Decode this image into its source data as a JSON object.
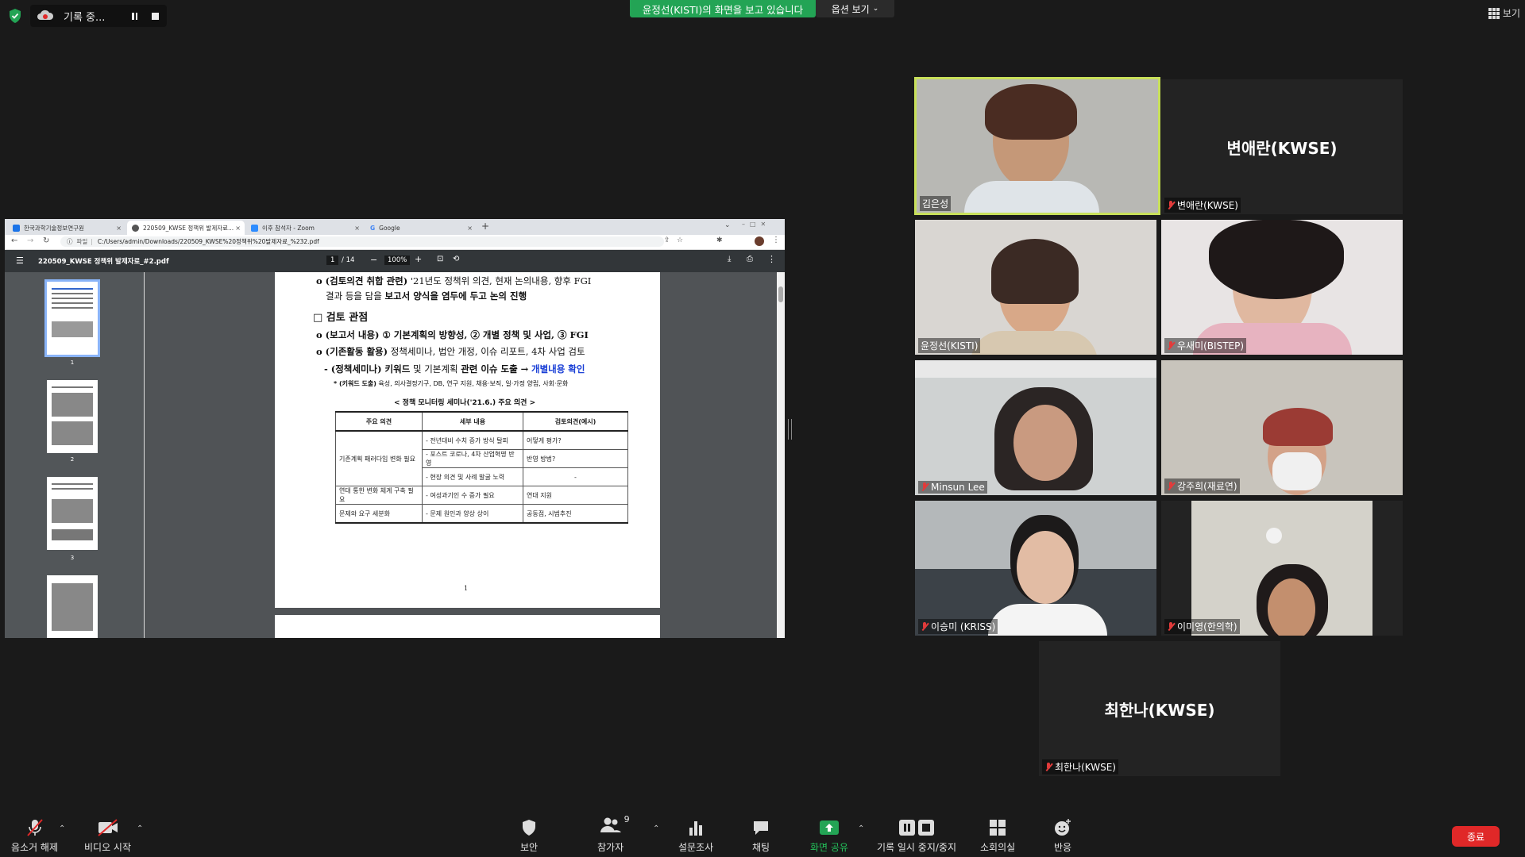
{
  "top": {
    "recording_label": "기록 중...",
    "sharing_banner": "윤정선(KISTI)의 화면을 보고 있습니다",
    "view_options": "옵션 보기",
    "view_label": "보기"
  },
  "browser": {
    "tabs": [
      {
        "label": "한국과학기술정보연구원",
        "color": "#1a73e8"
      },
      {
        "label": "220509_KWSE 정책위 발제자료...",
        "color": "#555555"
      },
      {
        "label": "이후 참석자 - Zoom",
        "color": "#2d8cff"
      },
      {
        "label": "Google",
        "color": "#4285f4"
      }
    ],
    "url_prefix": "파일",
    "url": "C:/Users/admin/Downloads/220509_KWSE%20정책위%20발제자료_%232.pdf"
  },
  "pdf": {
    "filename": "220509_KWSE 정책위 발제자료_#2.pdf",
    "page_current": "1",
    "page_total": "/ 14",
    "zoom": "100%",
    "thumb_numbers": [
      "1",
      "2",
      "3"
    ],
    "lines": {
      "l1a": "o (검토의견 취합 관련)",
      "l1b": "'21년도 정책위 의견, 현재 논의내용, 향후 FGI",
      "l2a": "결과 등을 담을",
      "l2b": "보고서 양식을 염두에 두고 논의 진행",
      "h1": "□ 검토 관점",
      "l3": "o (보고서 내용) ① 기본계획의 방향성, ② 개별 정책 및 사업, ③ FGI",
      "l4a": "o (기존활동 활용)",
      "l4b": "정책세미나, 법안 개정, 이슈 리포트, 4차 사업 검토",
      "l5a": "- (정책세미나) 키워드",
      "l5b": "및 기본계획",
      "l5c": "관련 이슈 도출 →",
      "l5d": "개별내용 확인",
      "l6a": "* (키워드 도출)",
      "l6b": "육성, 의사결정기구, DB, 연구 지원, 채용·보직, 일·가정 양립, 사회·문화",
      "caption": "< 정책 모니터링 세미나('21.6.) 주요 의견 >",
      "page_no": "1"
    },
    "table": {
      "headers": [
        "주요 의견",
        "세부 내용",
        "검토의견(예시)"
      ],
      "row1_main": "기존계획 패러다임 변화 필요",
      "row1_details": [
        {
          "detail": "- 전년대비 수치 증가 방식 탈피",
          "review": "어떻게 평가?"
        },
        {
          "detail": "- 포스트 코로나, 4차 산업혁명 반영",
          "review": "반영 방법?"
        },
        {
          "detail": "- 현장 의견 및 사례 발굴 노력",
          "review": "-"
        }
      ],
      "row2": {
        "main": "연대 통한 변화 체계 구축 필요",
        "detail": "- 여성과기인 수 증가 필요",
        "review": "연대 지원"
      },
      "row3": {
        "main": "문제와 요구 세분화",
        "detail": "- 문제 원인과 양상 상이",
        "review": "공동점, 시범추진"
      }
    }
  },
  "participants": [
    {
      "name": "김은성",
      "muted": false,
      "active": true,
      "video": true
    },
    {
      "name": "변애란(KWSE)",
      "muted": true,
      "active": false,
      "video": false
    },
    {
      "name": "윤정선(KISTI)",
      "muted": false,
      "active": false,
      "video": true
    },
    {
      "name": "우새미(BISTEP)",
      "muted": true,
      "active": false,
      "video": true
    },
    {
      "name": "Minsun Lee",
      "muted": true,
      "active": false,
      "video": true
    },
    {
      "name": "강주희(재료연)",
      "muted": true,
      "active": false,
      "video": true
    },
    {
      "name": "이승미 (KRISS)",
      "muted": true,
      "active": false,
      "video": true
    },
    {
      "name": "이미영(한의학)",
      "muted": true,
      "active": false,
      "video": true
    },
    {
      "name": "최한나(KWSE)",
      "muted": true,
      "active": false,
      "video": false
    }
  ],
  "toolbar": {
    "unmute": "음소거 해제",
    "start_video": "비디오 시작",
    "security": "보안",
    "participants": "참가자",
    "participants_count": "9",
    "polls": "설문조사",
    "chat": "채팅",
    "share_screen": "화면 공유",
    "pause_recording": "기록 일시 중지/중지",
    "breakout": "소회의실",
    "reactions": "반응",
    "end": "종료"
  },
  "colors": {
    "banner_green": "#23a455",
    "share_green": "#23a455",
    "end_red": "#e02828",
    "active_speaker_border": "#c8e05a",
    "link_blue": "#1a3fd6"
  }
}
